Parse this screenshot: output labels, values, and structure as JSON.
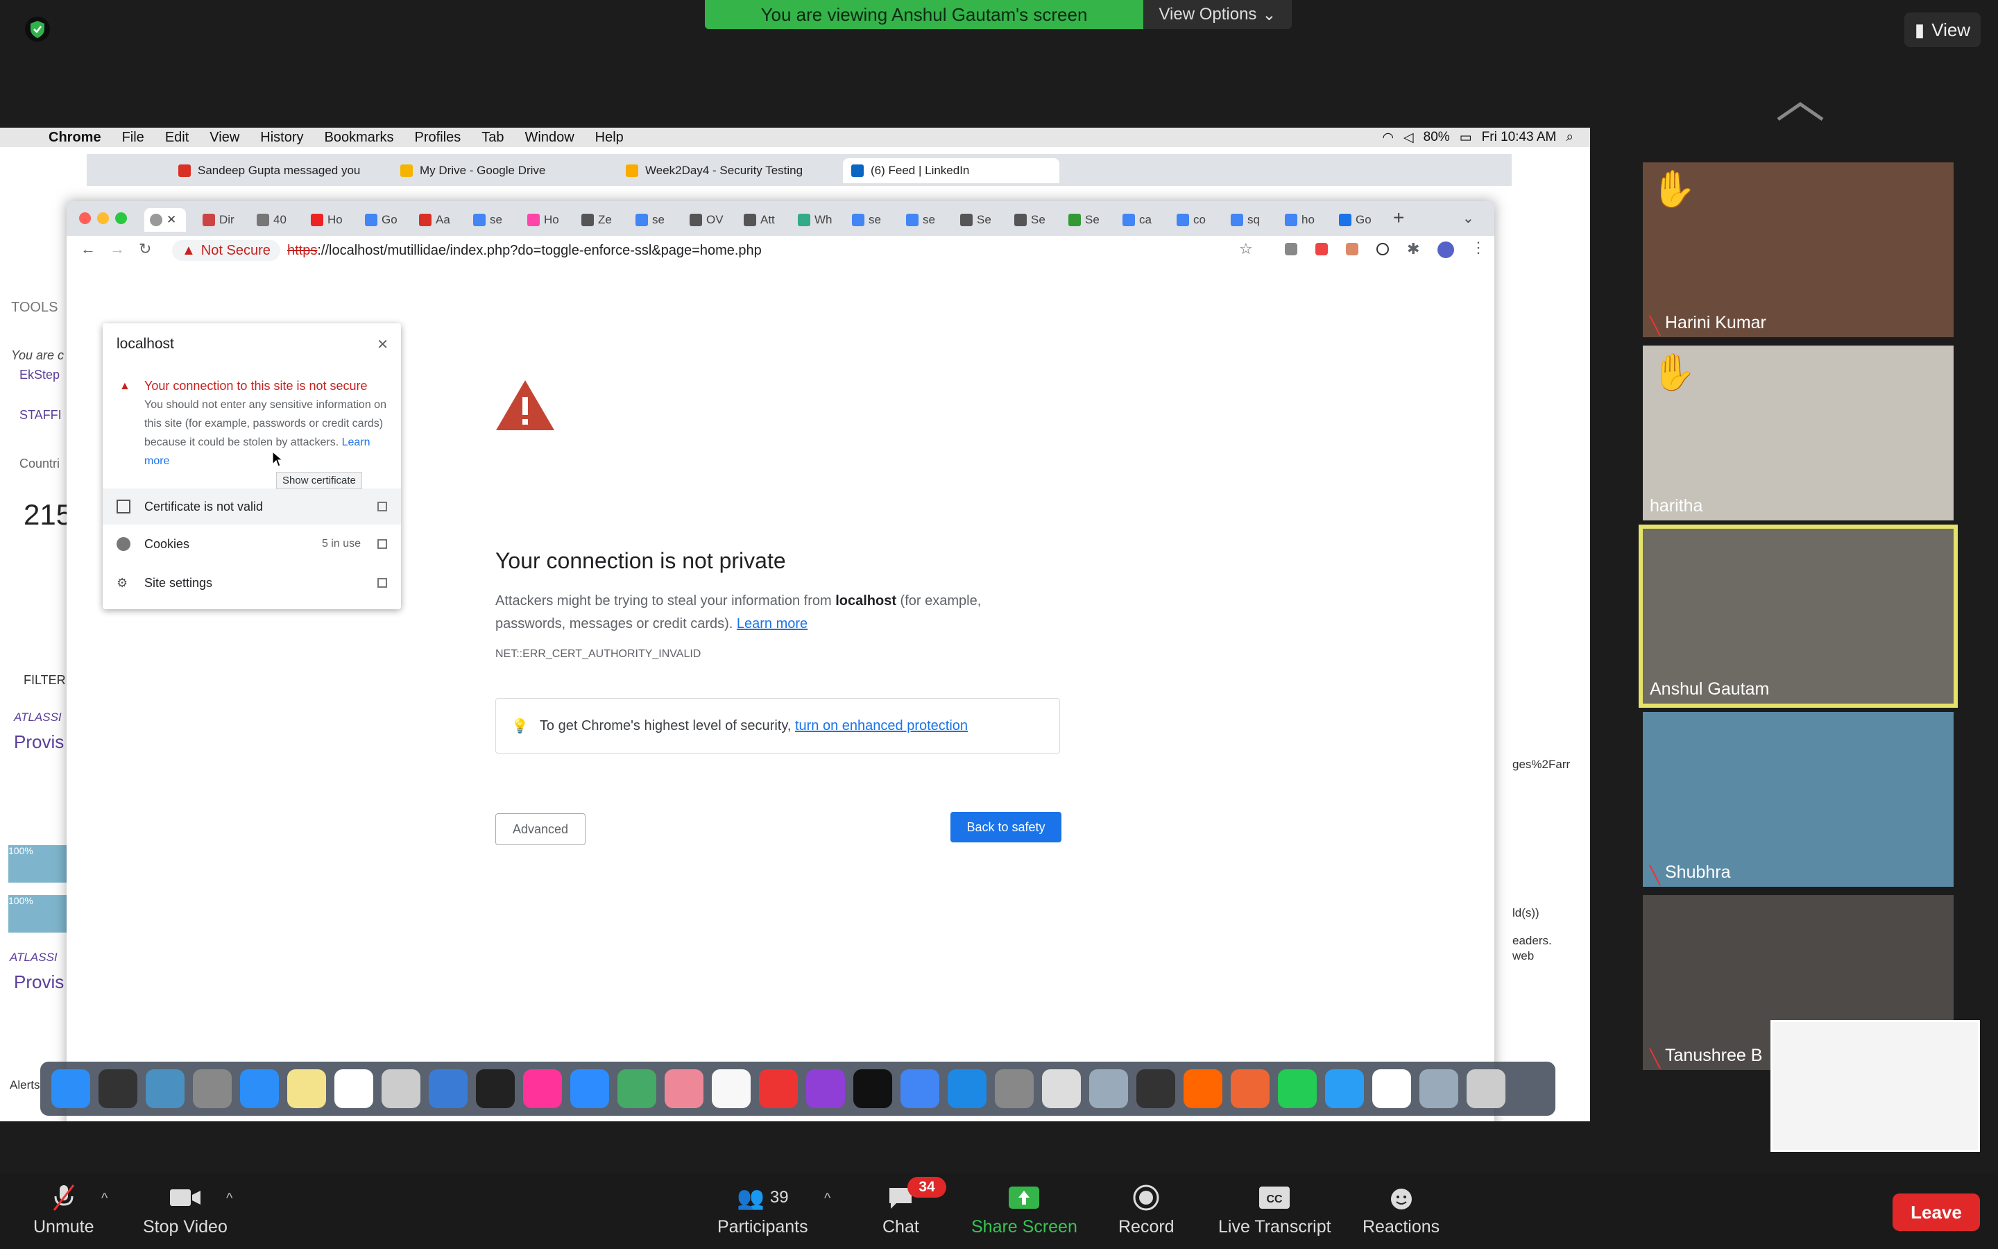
{
  "zoom": {
    "banner_text": "You are viewing Anshul Gautam's screen",
    "view_options_label": "View Options",
    "view_label": "View",
    "controls": {
      "unmute": "Unmute",
      "stop_video": "Stop Video",
      "participants": "Participants",
      "participants_count": "39",
      "chat": "Chat",
      "chat_badge": "34",
      "share_screen": "Share Screen",
      "record": "Record",
      "live_transcript": "Live Transcript",
      "reactions": "Reactions",
      "leave": "Leave"
    },
    "participants": [
      {
        "name": "Harini Kumar",
        "hand_raised": true,
        "muted": true
      },
      {
        "name": "haritha",
        "hand_raised": true,
        "muted": false
      },
      {
        "name": "Anshul Gautam",
        "hand_raised": false,
        "muted": false,
        "active_speaker": true
      },
      {
        "name": "Shubhra",
        "hand_raised": false,
        "muted": true
      },
      {
        "name": "Tanushree B",
        "hand_raised": false,
        "muted": true
      }
    ],
    "accent_green": "#35b44a",
    "leave_color": "#e02828"
  },
  "mac": {
    "app": "Chrome",
    "menus": [
      "File",
      "Edit",
      "View",
      "History",
      "Bookmarks",
      "Profiles",
      "Tab",
      "Window",
      "Help"
    ],
    "battery": "80%",
    "clock": "Fri 10:43 AM"
  },
  "bg_tabs": [
    {
      "title": "Sandeep Gupta messaged you"
    },
    {
      "title": "My Drive - Google Drive"
    },
    {
      "title": "Week2Day4 - Security Testing"
    },
    {
      "title": "(6) Feed | LinkedIn"
    }
  ],
  "main_tabs": [
    "Dir",
    "40",
    "Ho",
    "Go",
    "Aa",
    "se",
    "Ho",
    "Ze",
    "se",
    "OV",
    "Att",
    "Wh",
    "se",
    "se",
    "Se",
    "Se",
    "Se",
    "ca",
    "co",
    "sq",
    "ho",
    "Go"
  ],
  "behind": {
    "tools": "TOOLS",
    "you_are": "You are c",
    "ekstep": "EkStep",
    "staffing": "STAFFI",
    "countries": "Countri",
    "big_number": "215",
    "filter": "FILTER",
    "atlassian": "ATLASSI",
    "provis": "Provis",
    "atlassian2": "ATLASSI",
    "provis2": "Provis",
    "pct1": "100%",
    "pct2": "100%",
    "alerts": "Alerts",
    "right_frag1": "ges%2Farr",
    "right_frag2": "ld(s))",
    "right_frag3": "eaders.",
    "right_frag4": "web"
  },
  "addressbar": {
    "not_secure": "Not Secure",
    "url_scheme": "https",
    "url_rest": "://localhost/mutillidae/index.php?do=toggle-enforce-ssl&page=home.php"
  },
  "error": {
    "title": "Your connection is not private",
    "body_pre": "Attackers might be trying to steal your information from ",
    "host": "localhost",
    "body_post": " (for example, passwords, messages or credit cards). ",
    "learn_more": "Learn more",
    "code": "NET::ERR_CERT_AUTHORITY_INVALID",
    "enhanced_pre": "To get Chrome's highest level of security, ",
    "enhanced_link": "turn on enhanced protection",
    "advanced": "Advanced",
    "back": "Back to safety"
  },
  "popup": {
    "host": "localhost",
    "warning_title": "Your connection to this site is not secure",
    "warning_text": "You should not enter any sensitive information on this site (for example, passwords or credit cards) because it could be stolen by attackers.",
    "learn_more": "Learn more",
    "certificate": "Certificate is not valid",
    "cookies": "Cookies",
    "cookies_count": "5 in use",
    "site_settings": "Site settings",
    "tooltip": "Show certificate"
  }
}
